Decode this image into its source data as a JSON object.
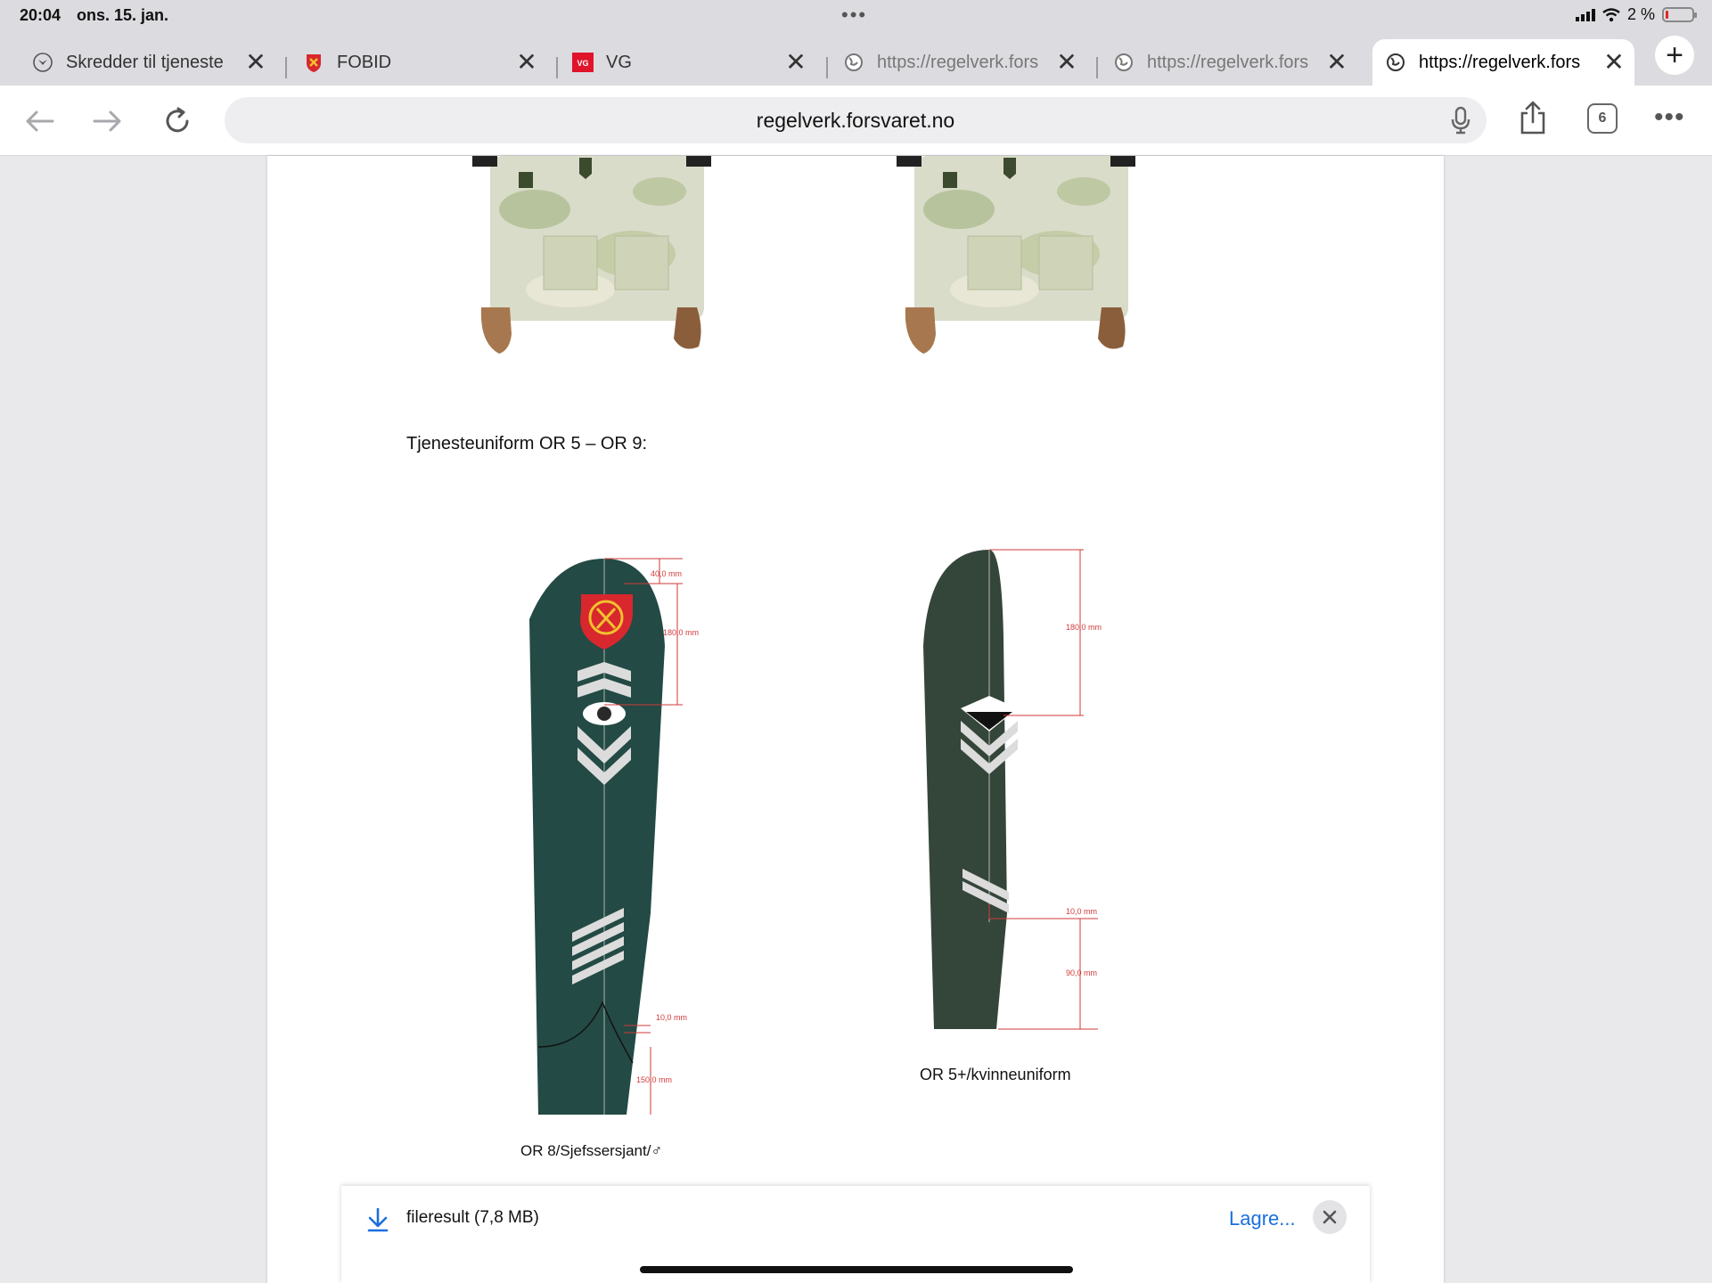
{
  "status_bar": {
    "time": "20:04",
    "date": "ons. 15. jan.",
    "battery": "2 %"
  },
  "tabs": [
    {
      "title": "Skredder til tjeneste",
      "favicon": "badge-icon",
      "active": false
    },
    {
      "title": "FOBID",
      "favicon": "crest-icon",
      "active": false
    },
    {
      "title": "VG",
      "favicon": "vg-logo-icon",
      "active": false
    },
    {
      "title": "https://regelverk.fors",
      "favicon": "globe-icon",
      "active": false
    },
    {
      "title": "https://regelverk.fors",
      "favicon": "globe-icon",
      "active": false
    },
    {
      "title": "https://regelverk.fors",
      "favicon": "globe-icon",
      "active": true
    }
  ],
  "toolbar": {
    "url": "regelverk.forsvaret.no",
    "tab_count": "6"
  },
  "document": {
    "heading": "Tjenesteuniform OR 5 – OR 9:",
    "left_figure": {
      "caption": "OR 8/Sjefssersjant/♂",
      "dims": {
        "top": "40,0 mm",
        "badge": "180,0 mm",
        "gap": "10,0 mm",
        "bottom": "150,0 mm"
      }
    },
    "right_figure": {
      "caption": "OR 5+/kvinneuniform",
      "dims": {
        "badge": "180,0 mm",
        "gap": "10,0 mm",
        "bottom": "90,0 mm"
      }
    }
  },
  "download": {
    "filename": "fileresult (7,8 MB)",
    "save_label": "Lagre..."
  },
  "colors": {
    "accent_blue": "#1a6fe0",
    "strap_left": "#234a44",
    "strap_right": "#344539",
    "dimension_red": "#d23a3a"
  }
}
